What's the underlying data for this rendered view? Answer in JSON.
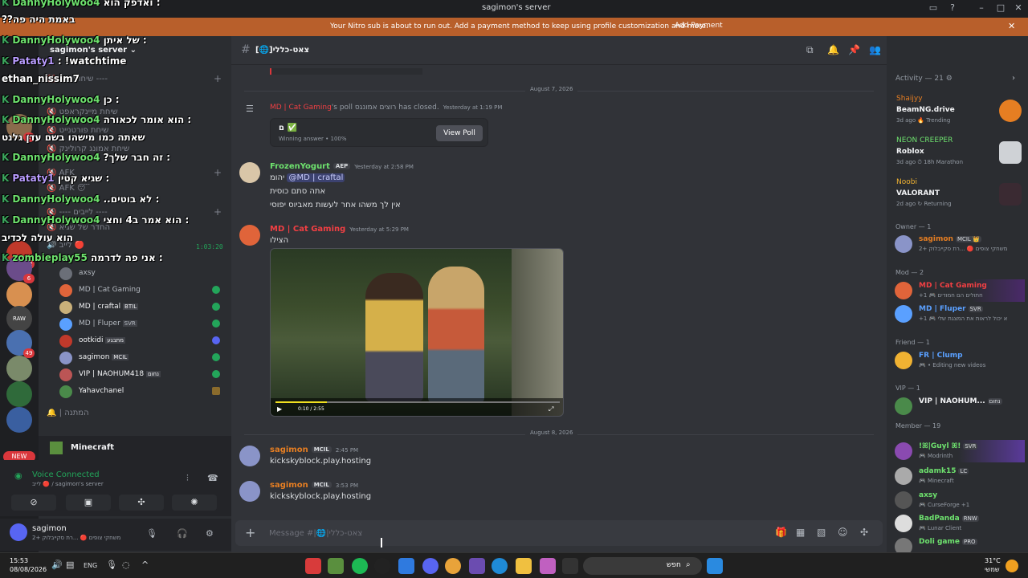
{
  "window": {
    "title": "sagimon's server"
  },
  "nitro": {
    "message": "Your Nitro sub is about to run out. Add a payment method to keep using profile customization and more.",
    "button": "Add Payment",
    "close": "✕"
  },
  "guilds": {
    "badges": [
      "1",
      "12",
      "6",
      "49"
    ],
    "new_label": "NEW",
    "raw_label": "RAW"
  },
  "sidebar": {
    "server_name": "sagimon's server ⌄",
    "channels": [
      "🔇 ---- שיחות ----",
      "🔇 שיחת מיינקראפט",
      "🔇 שיחת פורטנייט",
      "🔇 שיחת אמונג קרולינק",
      "🔇 AFK",
      "🔇 AFK 😴",
      "🔇 ---- לייבים ----",
      "🔇 החדר של שגיא",
      "🔊 לייב 🔴"
    ],
    "timer": "1:03:20",
    "voice_users": [
      "axsy",
      "MD | Cat Gaming",
      "MD | craftal",
      "MD | Fluper",
      "ootkidi",
      "sagimon",
      "VIP | NAOHUM418",
      "Yahavchanel"
    ],
    "voice_tags": [
      "",
      "",
      "BTIL",
      "SVR",
      "מתבגע",
      "MCIL",
      "נחום",
      ""
    ],
    "last_channel": "🔔 | המתנה"
  },
  "overlay": [
    {
      "user": "DannyHolywoo4",
      "text": "ואדפק הוא :",
      "style": "u"
    },
    {
      "user": "",
      "text": "??באמת היה פה",
      "style": ""
    },
    {
      "user": "DannyHolywoo4",
      "text": "של איתן :",
      "style": "u"
    },
    {
      "user": "Pataty1",
      "text": ": !watchtime",
      "style": "u2"
    },
    {
      "user": "",
      "text": "ethan_nissim7",
      "style": ""
    },
    {
      "user": "DannyHolywoo4",
      "text": "כן :",
      "style": "u"
    },
    {
      "user": "DannyHolywoo4",
      "text": "הוא אומר לכאורה :",
      "style": "u"
    },
    {
      "user": "",
      "text": "שאתה כמו מישהו בשם עדן גלנט",
      "style": ""
    },
    {
      "user": "DannyHolywoo4",
      "text": "?זה חבר שלך :",
      "style": "u"
    },
    {
      "user": "Pataty1",
      "text": "שגיא קטין :",
      "style": "u2"
    },
    {
      "user": "DannyHolywoo4",
      "text": "..לא בוטים :",
      "style": "u"
    },
    {
      "user": "DannyHolywoo4",
      "text": "הוא אמר ב4 וחצי :",
      "style": "u"
    },
    {
      "user": "",
      "text": "הוא עולה לכדיב",
      "style": ""
    },
    {
      "user": "zombieplay55",
      "text": "אני פה לדרמה :",
      "style": "u"
    }
  ],
  "activity_bar": {
    "game": "Minecraft"
  },
  "voice": {
    "status": "Voice Connected",
    "sub": "לייב 🔴 / sagimon's server",
    "buttons": [
      "⊘",
      "▣",
      "✣",
      "✺"
    ]
  },
  "user": {
    "name": "sagimon",
    "status": "משחקי צופים 🔴 ...רת סקייבלוק +2"
  },
  "channel": {
    "name": "[🌐]צאט-כללי",
    "hash": "#"
  },
  "messages": {
    "date1": "August 7, 2026",
    "poll_system": {
      "author": "MD | Cat Gaming",
      "text": "'s poll רוצים אמונגס has closed.",
      "time": "Yesterday at 1:19 PM"
    },
    "poll": {
      "answer": "ם ✅",
      "sub": "Winning answer • 100%",
      "button": "View Poll"
    },
    "m1": {
      "author": "FrozenYogurt",
      "tag": "AEP",
      "time": "Yesterday at 2:58 PM",
      "mention": "@MD | craftal",
      "prefix": "יהומ ",
      "lines": [
        "אתה סתם כוסית",
        "אין לך משהו אחר לעשות מאביוס יפוסי"
      ]
    },
    "m2": {
      "author": "MD | Cat Gaming",
      "time": "Yesterday at 5:29 PM",
      "line": "הצילו"
    },
    "video": {
      "progress": 0.18,
      "time": "0:10 / 2:55"
    },
    "date2": "August 8, 2026",
    "m3": {
      "author": "sagimon",
      "tag": "MCIL",
      "time": "2:45 PM",
      "line": "kickskyblock.play.hosting"
    },
    "m4": {
      "author": "sagimon",
      "tag": "MCIL",
      "time": "3:53 PM",
      "line": "kickskyblock.play.hosting"
    }
  },
  "composer": {
    "placeholder": "Message #|🌐|צאט-כללי",
    "plus": "+"
  },
  "members": {
    "search_placeholder": "Search sagimon's server",
    "activity_header": "Activity — 21 ⚙",
    "activities": [
      {
        "user": "Shaijyy",
        "game": "BeamNG.drive",
        "meta": "3d ago  🔥 Trending",
        "color": "#e67e22",
        "art": "#e67e22"
      },
      {
        "user": "NEON CREEPER",
        "game": "Roblox",
        "meta": "3d ago  ⏱ 18h Marathon",
        "color": "#6ee26e",
        "art": "#cfd2d6"
      },
      {
        "user": "Noobi",
        "game": "VALORANT",
        "meta": "2d ago  ↻ Returning",
        "color": "#f0b232",
        "art": "#ff4655"
      }
    ],
    "groups": [
      {
        "title": "Owner — 1",
        "items": [
          {
            "name": "sagimon",
            "tag": "MCIL 👑",
            "status": "משחקי צופים 🔴 ...רת סקייבלוק +2",
            "color": "#e67e22"
          }
        ]
      },
      {
        "title": "Mod — 2",
        "items": [
          {
            "name": "MD | Cat Gaming",
            "tag": "",
            "status": "+1 🎮 חתולים הם חמודים",
            "color": "#f23f43"
          },
          {
            "name": "MD | Fluper",
            "tag": "SVR",
            "status": "+1 🎮 א יכול לראות את המצגת שלי",
            "color": "#5aa0ff"
          }
        ]
      },
      {
        "title": "Friend — 1",
        "items": [
          {
            "name": "FR | Clump",
            "tag": "",
            "status": "🎮 • Editing new videos",
            "color": "#5aa0ff"
          }
        ]
      },
      {
        "title": "VIP — 1",
        "items": [
          {
            "name": "VIP | NAOHUM...",
            "tag": "נחום",
            "status": "",
            "color": "#f2f3f5"
          }
        ]
      },
      {
        "title": "Member — 19",
        "items": [
          {
            "name": "!ꕤ|Guyl ꕤ!",
            "tag": "SVR",
            "status": "🎮 Modrinth",
            "color": "#6ee26e"
          },
          {
            "name": "adamk15",
            "tag": "LC",
            "status": "🎮 Minecraft",
            "color": "#6ee26e"
          },
          {
            "name": "axsy",
            "tag": "",
            "status": "🎮 CurseForge +1",
            "color": "#6ee26e"
          },
          {
            "name": "BadPanda",
            "tag": "RNW",
            "status": "🎮 Lunar Client",
            "color": "#6ee26e"
          },
          {
            "name": "Doli game",
            "tag": "PRO",
            "status": "",
            "color": "#6ee26e"
          }
        ]
      }
    ]
  },
  "taskbar": {
    "time": "15:53",
    "date": "08/08/2026",
    "lang": "ENG",
    "search": "חפש",
    "weather": "31°C",
    "weather_sub": "שמשי"
  }
}
